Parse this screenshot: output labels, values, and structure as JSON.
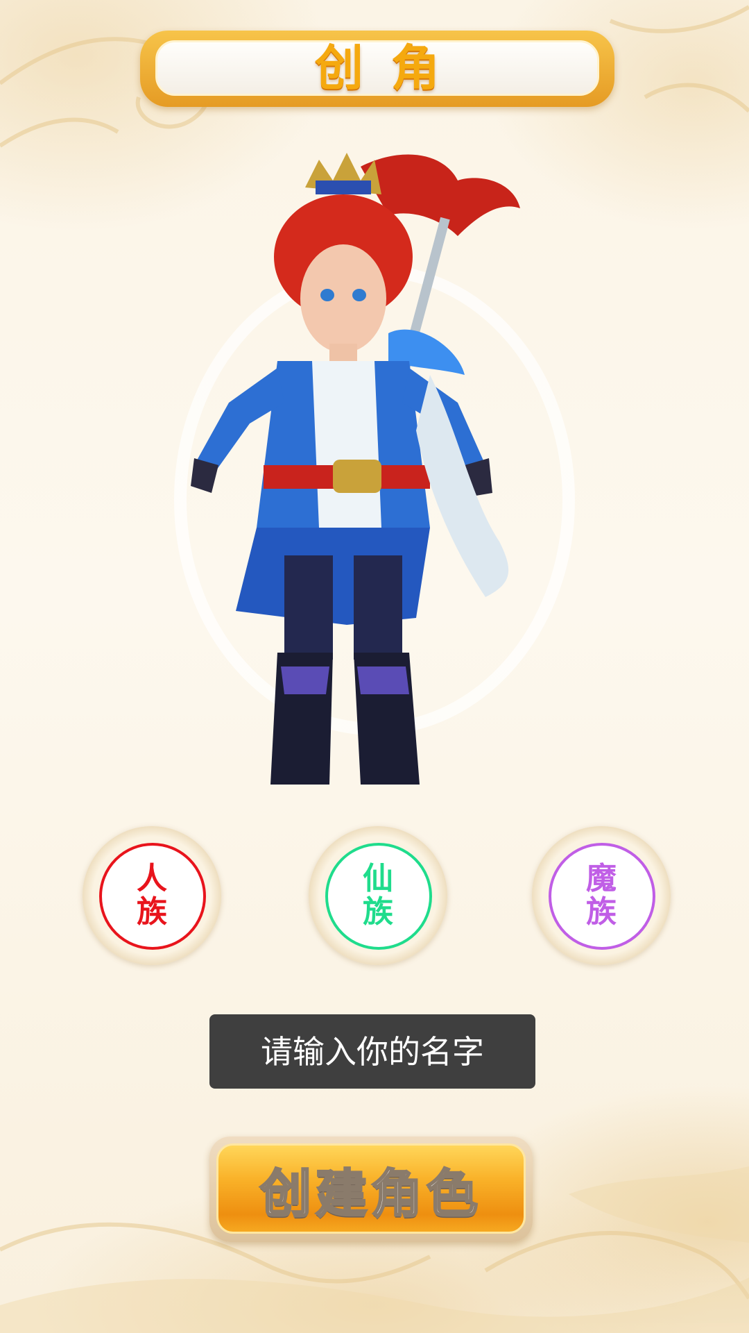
{
  "header": {
    "title": "创角"
  },
  "factions": [
    {
      "label_line1": "人",
      "label_line2": "族",
      "color": "#e8141c"
    },
    {
      "label_line1": "仙",
      "label_line2": "族",
      "color": "#1fdc8c"
    },
    {
      "label_line1": "魔",
      "label_line2": "族",
      "color": "#c05ee6"
    }
  ],
  "name_input": {
    "placeholder": "请输入你的名字",
    "value": ""
  },
  "create_button": {
    "label": "创建角色"
  },
  "colors": {
    "title_gold": "#f5a90f",
    "button_orange": "#f9b128",
    "input_bg": "#3f3f3f",
    "page_bg": "#fbf5e8"
  }
}
